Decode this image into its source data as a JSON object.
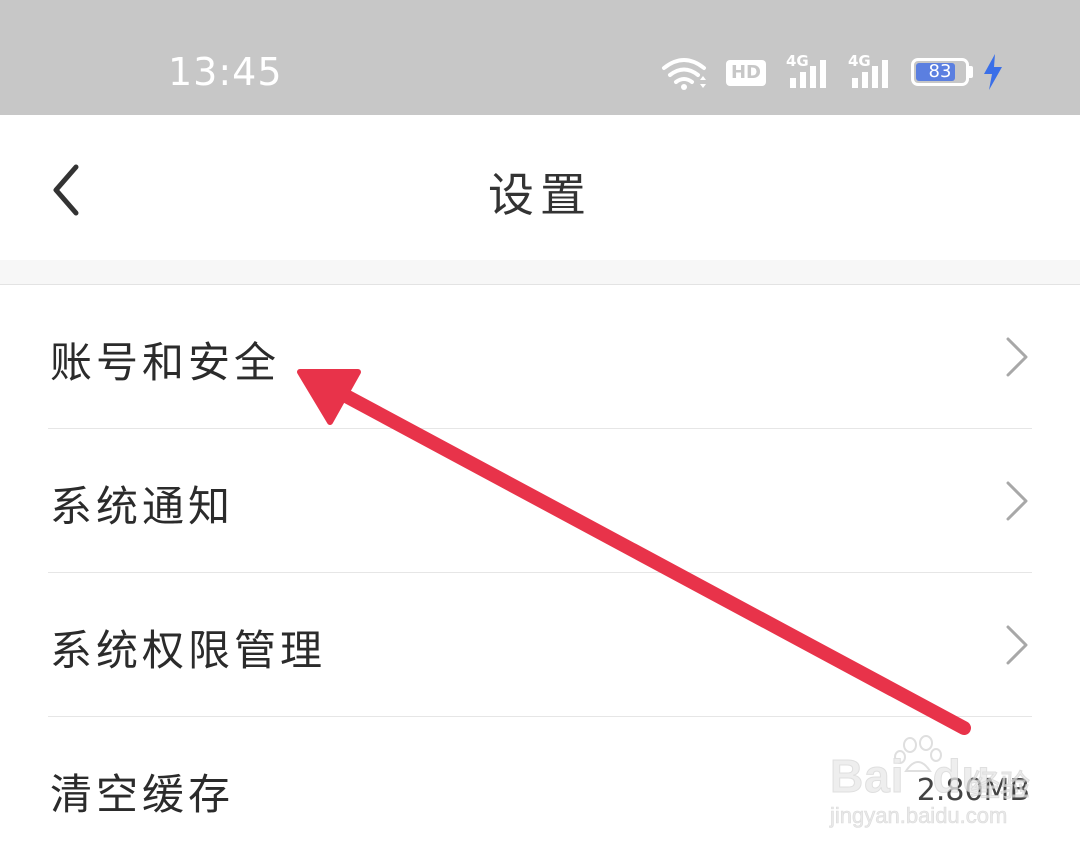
{
  "status_bar": {
    "time": "13:45",
    "hd_badge": "HD",
    "network_1": "4G",
    "network_2": "4G",
    "battery_level": 83,
    "battery_text": "83",
    "icons": [
      "wifi-icon",
      "hd-voice-icon",
      "signal-icon",
      "signal-icon",
      "battery-icon",
      "charging-bolt-icon"
    ],
    "charging_color": "#3a6fe8"
  },
  "header": {
    "title": "设置",
    "back_icon": "chevron-left-icon"
  },
  "settings": {
    "items": [
      {
        "label": "账号和安全",
        "trailing": "chevron-right-icon"
      },
      {
        "label": "系统通知",
        "trailing": "chevron-right-icon"
      },
      {
        "label": "系统权限管理",
        "trailing": "chevron-right-icon"
      },
      {
        "label": "清空缓存",
        "value": "2.80MB"
      }
    ]
  },
  "annotation": {
    "type": "arrow",
    "color": "#e8334a",
    "points_to": "账号和安全"
  },
  "watermark": {
    "brand": "Bai",
    "brand_suffix": "du",
    "sub": "经验",
    "url": "jingyan.baidu.com"
  }
}
